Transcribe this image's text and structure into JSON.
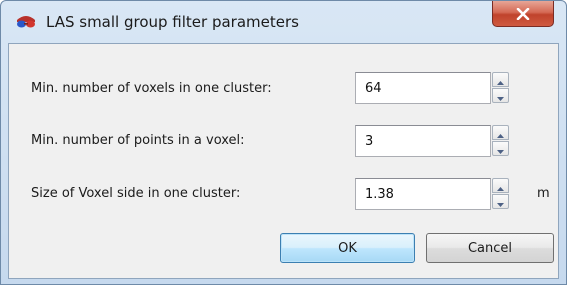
{
  "window": {
    "title": "LAS small group filter parameters"
  },
  "icons": {
    "app": "red-blue-glasses-icon",
    "close": "close-x-icon",
    "spin_up": "triangle-up-icon",
    "spin_down": "triangle-down-icon"
  },
  "fields": [
    {
      "label": "Min. number of voxels in one cluster:",
      "value": "64",
      "unit": ""
    },
    {
      "label": "Min. number of points in a voxel:",
      "value": "3",
      "unit": ""
    },
    {
      "label": "Size of Voxel side in one cluster:",
      "value": "1.38",
      "unit": "m"
    }
  ],
  "buttons": {
    "ok": "OK",
    "cancel": "Cancel"
  },
  "colors": {
    "titlebar": "#c6d9ee",
    "client": "#f0f0f0",
    "close_button": "#c0432c",
    "default_button_border": "#3c7fb1"
  }
}
